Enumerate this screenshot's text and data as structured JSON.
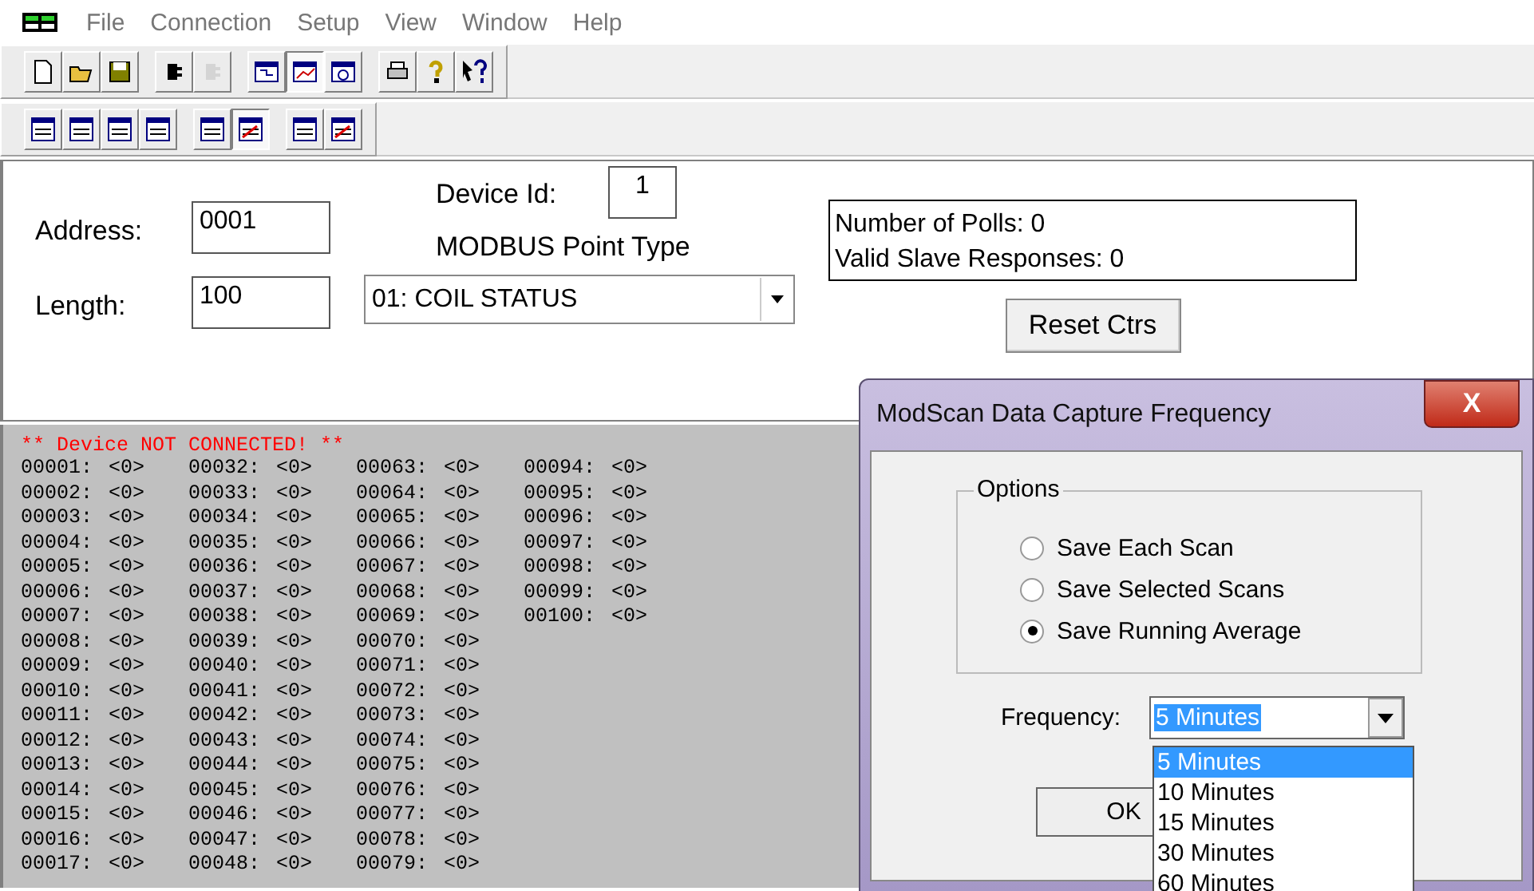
{
  "menu": [
    {
      "label": "File"
    },
    {
      "label": "Connection"
    },
    {
      "label": "Setup"
    },
    {
      "label": "View"
    },
    {
      "label": "Window"
    },
    {
      "label": "Help"
    }
  ],
  "toolbar_main": [
    [
      {
        "pressed": false,
        "disabled": false
      },
      {
        "pressed": false,
        "disabled": false
      },
      {
        "pressed": false,
        "disabled": false
      }
    ],
    [
      {
        "pressed": false,
        "disabled": false
      },
      {
        "pressed": false,
        "disabled": true
      }
    ],
    [
      {
        "pressed": false,
        "disabled": false
      },
      {
        "pressed": true,
        "disabled": false
      },
      {
        "pressed": false,
        "disabled": false
      }
    ],
    [
      {
        "pressed": false,
        "disabled": false
      },
      {
        "pressed": false,
        "disabled": false
      },
      {
        "pressed": false,
        "disabled": false
      }
    ]
  ],
  "toolbar_display": [
    [
      {
        "pressed": false
      },
      {
        "pressed": false
      },
      {
        "pressed": false
      },
      {
        "pressed": false
      }
    ],
    [
      {
        "pressed": false
      },
      {
        "pressed": true
      }
    ],
    [
      {
        "pressed": false
      },
      {
        "pressed": false
      }
    ]
  ],
  "form": {
    "address": {
      "label": "Address:",
      "value": "0001"
    },
    "length": {
      "label": "Length:",
      "value": "100"
    },
    "device_id": {
      "label": "Device Id:",
      "value": "1"
    },
    "point_type": {
      "label": "MODBUS Point Type",
      "value": "01: COIL STATUS"
    }
  },
  "counters": [
    "Number of Polls: 0",
    "Valid Slave Responses: 0"
  ],
  "reset_button": "Reset Ctrs",
  "status": "** Device NOT CONNECTED! **",
  "data_columns": [
    [
      [
        "00001:",
        "<0>"
      ],
      [
        "00002:",
        "<0>"
      ],
      [
        "00003:",
        "<0>"
      ],
      [
        "00004:",
        "<0>"
      ],
      [
        "00005:",
        "<0>"
      ],
      [
        "00006:",
        "<0>"
      ],
      [
        "00007:",
        "<0>"
      ],
      [
        "00008:",
        "<0>"
      ],
      [
        "00009:",
        "<0>"
      ],
      [
        "00010:",
        "<0>"
      ],
      [
        "00011:",
        "<0>"
      ],
      [
        "00012:",
        "<0>"
      ],
      [
        "00013:",
        "<0>"
      ],
      [
        "00014:",
        "<0>"
      ],
      [
        "00015:",
        "<0>"
      ],
      [
        "00016:",
        "<0>"
      ],
      [
        "00017:",
        "<0>"
      ]
    ],
    [
      [
        "00032:",
        "<0>"
      ],
      [
        "00033:",
        "<0>"
      ],
      [
        "00034:",
        "<0>"
      ],
      [
        "00035:",
        "<0>"
      ],
      [
        "00036:",
        "<0>"
      ],
      [
        "00037:",
        "<0>"
      ],
      [
        "00038:",
        "<0>"
      ],
      [
        "00039:",
        "<0>"
      ],
      [
        "00040:",
        "<0>"
      ],
      [
        "00041:",
        "<0>"
      ],
      [
        "00042:",
        "<0>"
      ],
      [
        "00043:",
        "<0>"
      ],
      [
        "00044:",
        "<0>"
      ],
      [
        "00045:",
        "<0>"
      ],
      [
        "00046:",
        "<0>"
      ],
      [
        "00047:",
        "<0>"
      ],
      [
        "00048:",
        "<0>"
      ]
    ],
    [
      [
        "00063:",
        "<0>"
      ],
      [
        "00064:",
        "<0>"
      ],
      [
        "00065:",
        "<0>"
      ],
      [
        "00066:",
        "<0>"
      ],
      [
        "00067:",
        "<0>"
      ],
      [
        "00068:",
        "<0>"
      ],
      [
        "00069:",
        "<0>"
      ],
      [
        "00070:",
        "<0>"
      ],
      [
        "00071:",
        "<0>"
      ],
      [
        "00072:",
        "<0>"
      ],
      [
        "00073:",
        "<0>"
      ],
      [
        "00074:",
        "<0>"
      ],
      [
        "00075:",
        "<0>"
      ],
      [
        "00076:",
        "<0>"
      ],
      [
        "00077:",
        "<0>"
      ],
      [
        "00078:",
        "<0>"
      ],
      [
        "00079:",
        "<0>"
      ]
    ],
    [
      [
        "00094:",
        "<0>"
      ],
      [
        "00095:",
        "<0>"
      ],
      [
        "00096:",
        "<0>"
      ],
      [
        "00097:",
        "<0>"
      ],
      [
        "00098:",
        "<0>"
      ],
      [
        "00099:",
        "<0>"
      ],
      [
        "00100:",
        "<0>"
      ]
    ]
  ],
  "dialog": {
    "title": "ModScan Data Capture Frequency",
    "close": "X",
    "options_label": "Options",
    "options": [
      {
        "label": "Save Each Scan",
        "selected": false
      },
      {
        "label": "Save Selected Scans",
        "selected": false
      },
      {
        "label": "Save Running Average",
        "selected": true
      }
    ],
    "frequency_label": "Frequency:",
    "frequency_value": "5 Minutes",
    "frequency_list": [
      {
        "label": "5 Minutes",
        "selected": true
      },
      {
        "label": "10 Minutes",
        "selected": false
      },
      {
        "label": "15 Minutes",
        "selected": false
      },
      {
        "label": "30 Minutes",
        "selected": false
      },
      {
        "label": "60 Minutes",
        "selected": false
      }
    ],
    "ok": "OK"
  }
}
